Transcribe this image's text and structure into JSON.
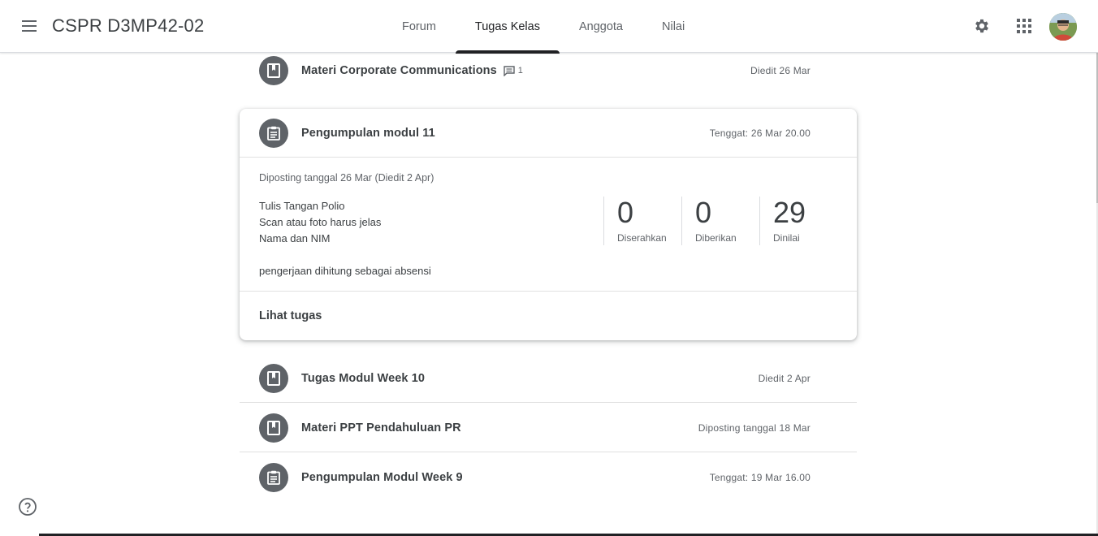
{
  "header": {
    "title": "CSPR D3MP42-02",
    "tabs": [
      {
        "label": "Forum",
        "active": false
      },
      {
        "label": "Tugas Kelas",
        "active": true
      },
      {
        "label": "Anggota",
        "active": false
      },
      {
        "label": "Nilai",
        "active": false
      }
    ],
    "icons": [
      "menu-icon",
      "gear-icon",
      "apps-grid-icon",
      "avatar"
    ]
  },
  "items": [
    {
      "type": "material",
      "icon": "book-icon",
      "title": "Materi Corporate Communications",
      "comments": "1",
      "date": "Diedit 26 Mar"
    },
    {
      "type": "material",
      "icon": "book-icon",
      "title": "Tugas Modul Week 10",
      "date": "Diedit 2 Apr"
    },
    {
      "type": "material",
      "icon": "book-icon",
      "title": "Materi PPT Pendahuluan PR",
      "date": "Diposting tanggal 18 Mar"
    },
    {
      "type": "assignment",
      "icon": "assignment-icon",
      "title": "Pengumpulan Modul Week 9",
      "date": "Tenggat: 19 Mar 16.00"
    }
  ],
  "expanded": {
    "icon": "assignment-icon",
    "title": "Pengumpulan modul 11",
    "due": "Tenggat: 26 Mar 20.00",
    "posted": "Diposting tanggal 26 Mar (Diedit 2 Apr)",
    "description": [
      "Tulis Tangan Polio",
      "Scan atau foto harus jelas",
      "Nama dan NIM",
      "",
      "pengerjaan dihitung sebagai absensi"
    ],
    "stats": [
      {
        "value": "0",
        "label": "Diserahkan"
      },
      {
        "value": "0",
        "label": "Diberikan"
      },
      {
        "value": "29",
        "label": "Dinilai"
      }
    ],
    "view_label": "Lihat tugas"
  },
  "colors": {
    "icon_circle": "#5f6368",
    "text": "#3c4043",
    "muted": "#5f6368",
    "divider": "#e0e0e0"
  }
}
